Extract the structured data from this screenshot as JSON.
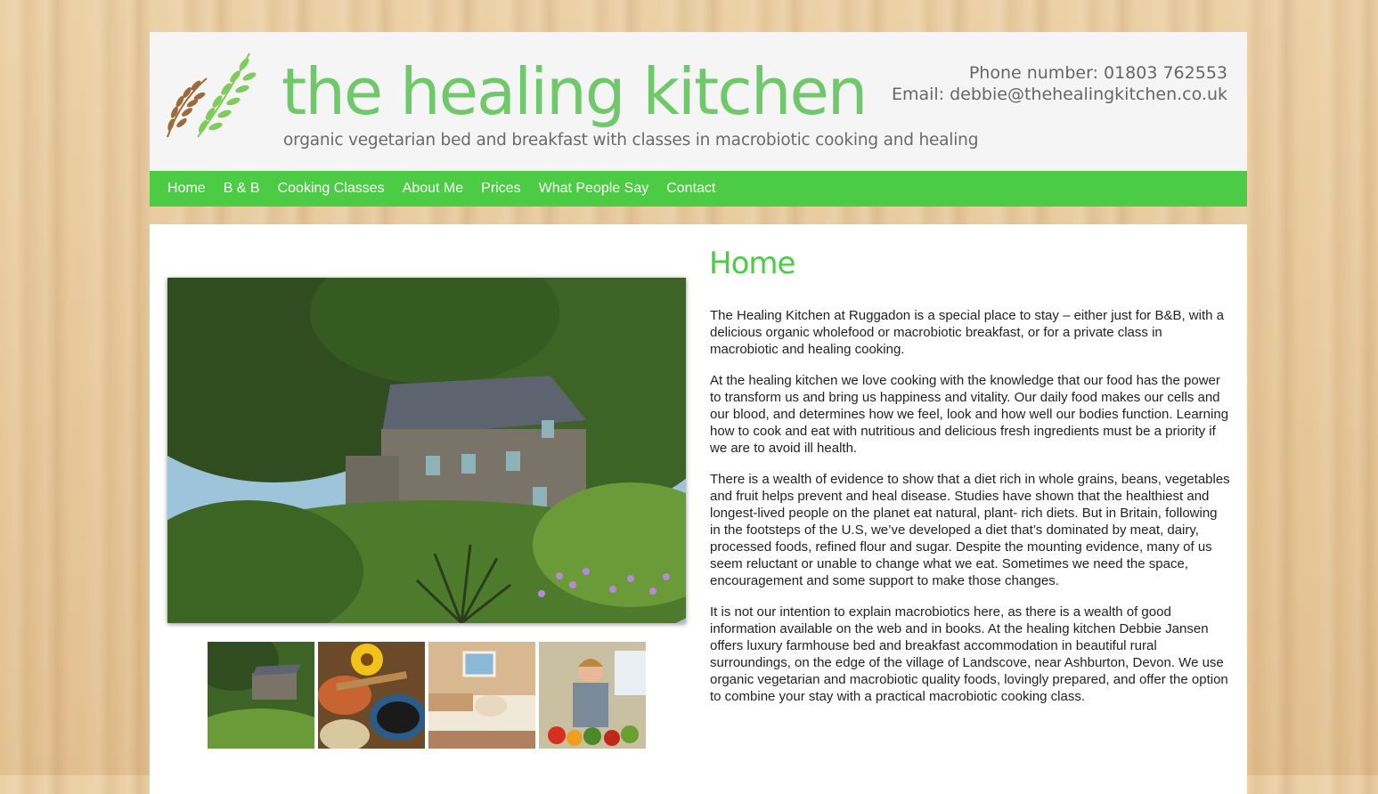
{
  "site": {
    "title": "the healing kitchen",
    "tagline": "organic vegetarian bed and breakfast with classes in macrobiotic cooking and healing",
    "phone": "Phone number: 01803 762553",
    "email": "Email: debbie@thehealingkitchen.co.uk"
  },
  "nav": {
    "items": [
      {
        "label": "Home"
      },
      {
        "label": "B & B"
      },
      {
        "label": "Cooking Classes"
      },
      {
        "label": "About Me"
      },
      {
        "label": "Prices"
      },
      {
        "label": "What People Say"
      },
      {
        "label": "Contact"
      }
    ]
  },
  "page": {
    "heading": "Home",
    "paragraphs": [
      "The Healing Kitchen at Ruggadon is a special place to stay – either just for B&B, with a delicious organic wholefood or macrobiotic breakfast, or for a private class in macrobiotic and healing cooking.",
      "At the healing kitchen we love cooking with the knowledge that our food has the power to transform us and bring us happiness and vitality. Our daily food makes our cells and our blood, and determines how we feel, look and how well our bodies function. Learning how to cook and eat with nutritious and delicious fresh ingredients must be a priority if we are to avoid ill health.",
      "There is a wealth of evidence to show that a diet rich in whole grains, beans, vegetables and fruit helps prevent and heal disease. Studies have shown that the healthiest and longest-lived people on the planet eat natural, plant- rich diets. But in Britain, following in the footsteps of the U.S, we’ve developed a diet that’s dominated by meat, dairy, processed foods, refined flour and sugar. Despite the mounting evidence, many of us seem reluctant or unable to change what we eat. Sometimes we need the space, encouragement and some support to make those changes.",
      "It is not our intention to explain macrobiotics here, as there is a wealth of good information available on the web and in books. At the healing kitchen Debbie Jansen offers luxury farmhouse bed and breakfast accommodation in beautiful rural surroundings, on the edge of the village of Landscove, near Ashburton, Devon. We use organic vegetarian and macrobiotic quality foods, lovingly prepared, and offer the option to combine your stay with a practical macrobiotic cooking class."
    ]
  },
  "colors": {
    "accent_green": "#4bcc44",
    "title_green": "#6fc96b",
    "wood_background": "#e6c596"
  }
}
